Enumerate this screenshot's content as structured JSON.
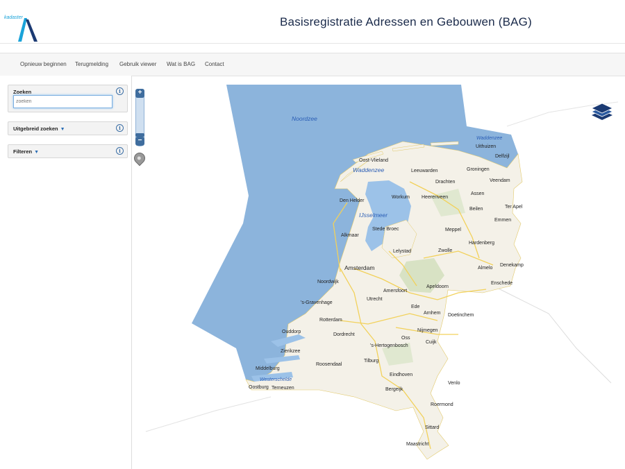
{
  "header": {
    "logo_text": "kadaster",
    "title": "Basisregistratie Adressen en Gebouwen (BAG)"
  },
  "nav": {
    "items": [
      "Opnieuw beginnen",
      "Terugmelding",
      "Gebruik viewer",
      "Wat is BAG",
      "Contact"
    ]
  },
  "sidebar": {
    "search": {
      "title": "Zoeken",
      "placeholder": "zoeken",
      "value": ""
    },
    "advanced": {
      "title": "Uitgebreid zoeken"
    },
    "filter": {
      "title": "Filteren"
    },
    "info_glyph": "i"
  },
  "map": {
    "zoom_in": "+",
    "zoom_out": "−",
    "layers_icon": "layers-icon",
    "colors": {
      "sea": "#8cb4dc",
      "land": "#f4f1e8",
      "water": "#9cc2e8",
      "road": "#f2d15a"
    },
    "water_labels": {
      "noordzee": "Noordzee",
      "waddenzee": "Waddenzee",
      "waddenzee_small": "Waddenzee",
      "ijsselmeer": "IJsselmeer",
      "westerschelde": "Westerschelde"
    },
    "cities": {
      "uithuizen": "Uithuizen",
      "delfzijl": "Delfzijl",
      "oost_vlieland": "Oost-Vlieland",
      "leeuwarden": "Leeuwarden",
      "groningen": "Groningen",
      "drachten": "Drachten",
      "veendam": "Veendam",
      "assen": "Assen",
      "den_helder": "Den Helder",
      "workum": "Workum",
      "heerenveen": "Heerenveen",
      "beilen": "Beilen",
      "ter_apel": "Ter Apel",
      "emmen": "Emmen",
      "stede_broec": "Stede Broec",
      "meppel": "Meppel",
      "alkmaar": "Alkmaar",
      "hardenberg": "Hardenberg",
      "lelystad": "Lelystad",
      "zwolle": "Zwolle",
      "amsterdam": "Amsterdam",
      "almelo": "Almelo",
      "denekamp": "Denekamp",
      "noordwijk": "Noordwijk",
      "apeldoorn": "Apeldoorn",
      "enschede": "Enschede",
      "amersfoort": "Amersfoort",
      "den_haag": "'s-Gravenhage",
      "utrecht": "Utrecht",
      "ede": "Ede",
      "arnhem": "Arnhem",
      "doetinchem": "Doetinchem",
      "rotterdam": "Rotterdam",
      "nijmegen": "Nijmegen",
      "ouddorp": "Ouddorp",
      "dordrecht": "Dordrecht",
      "oss": "Oss",
      "den_bosch": "'s-Hertogenbosch",
      "cuijk": "Cuijk",
      "zierikzee": "Zierikzee",
      "roosendaal": "Roosendaal",
      "tilburg": "Tilburg",
      "middelburg": "Middelburg",
      "eindhoven": "Eindhoven",
      "venlo": "Venlo",
      "oostburg": "Oostburg",
      "terneuzen": "Terneuzen",
      "bergeijk": "Bergeijk",
      "roermond": "Roermond",
      "sittard": "Sittard",
      "maastricht": "Maastricht"
    }
  }
}
